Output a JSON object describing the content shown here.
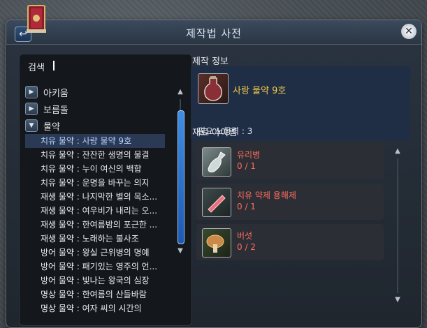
{
  "window": {
    "title": "제작법 사전"
  },
  "search": {
    "label": "검색",
    "value": ""
  },
  "categories": [
    {
      "label": "아키움",
      "expanded": false
    },
    {
      "label": "보름돌",
      "expanded": false
    },
    {
      "label": "물약",
      "expanded": true
    }
  ],
  "recipes": [
    {
      "label": "치유 물약 : 사랑 물약 9호",
      "selected": true
    },
    {
      "label": "치유 물약 : 잔잔한 생명의 물결",
      "selected": false
    },
    {
      "label": "치유 물약 : 누이 여신의 백합",
      "selected": false
    },
    {
      "label": "치유 물약 : 운명을 바꾸는 의지",
      "selected": false
    },
    {
      "label": "재생 물약 : 나지막한 별의 목소...",
      "selected": false
    },
    {
      "label": "재생 물약 : 여우비가 내리는 오...",
      "selected": false
    },
    {
      "label": "재생 물약 : 한여름밤의 포근한 ...",
      "selected": false
    },
    {
      "label": "재생 물약 : 노래하는 불사조",
      "selected": false
    },
    {
      "label": "방어 물약 : 왕실 근위병의 명예",
      "selected": false
    },
    {
      "label": "방어 물약 : 패기있는 영주의 언...",
      "selected": false
    },
    {
      "label": "방어 물약 : 빛나는 왕국의 심장",
      "selected": false
    },
    {
      "label": "명상 물약 : 한여름의 산들바람",
      "selected": false
    },
    {
      "label": "명상 물약 : 여자 씨의 시간의",
      "selected": false
    }
  ],
  "info": {
    "section_title": "제작 정보",
    "item_name": "사랑 물약 9호",
    "labor_label": "필요 노동력 : 3",
    "icon": "love-potion-icon"
  },
  "materials": {
    "section_title": "재료 아이템",
    "items": [
      {
        "name": "유리병",
        "count": "0 / 1",
        "icon": "glass-bottle-icon"
      },
      {
        "name": "치유 약제 용해제",
        "count": "0 / 1",
        "icon": "healing-solvent-icon"
      },
      {
        "name": "버섯",
        "count": "0 / 2",
        "icon": "mushroom-icon"
      }
    ]
  },
  "colors": {
    "accent": "#f2c94c",
    "missing": "#ff6b5d",
    "selected_text": "#b9d3ff"
  }
}
